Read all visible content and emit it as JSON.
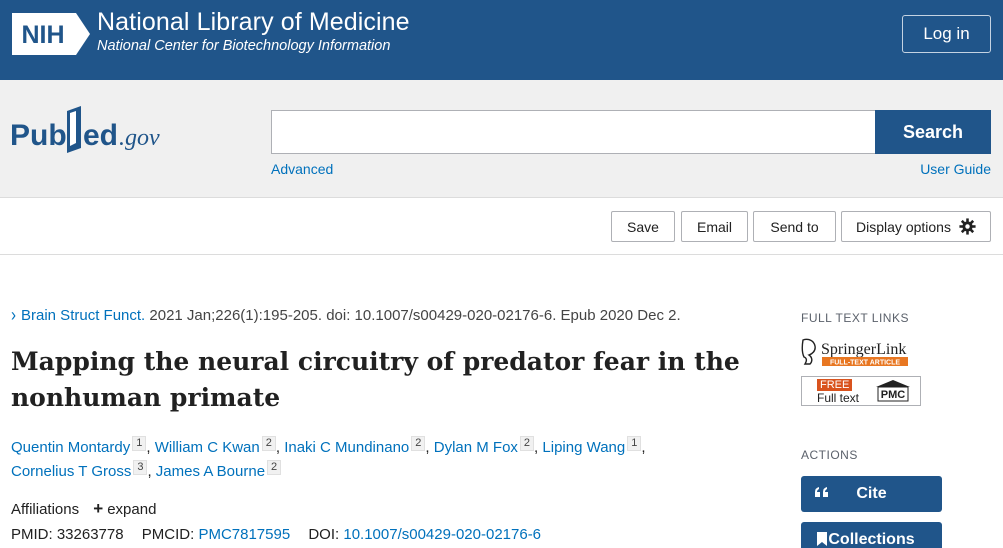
{
  "header": {
    "logo_text": "NIH",
    "org_title": "National Library of Medicine",
    "org_subtitle": "National Center for Biotechnology Information",
    "login_label": "Log in"
  },
  "search": {
    "logo_text": "PubMed.gov",
    "placeholder": "",
    "button_label": "Search",
    "advanced_label": "Advanced",
    "guide_label": "User Guide"
  },
  "toolbar": {
    "save_label": "Save",
    "email_label": "Email",
    "send_label": "Send to",
    "display_label": "Display options"
  },
  "article": {
    "journal": "Brain Struct Funct.",
    "citation": "2021 Jan;226(1):195-205. doi: 10.1007/s00429-020-02176-6. Epub 2020 Dec 2.",
    "title": "Mapping the neural circuitry of predator fear in the nonhuman primate",
    "authors": [
      {
        "name": "Quentin Montardy",
        "aff": "1"
      },
      {
        "name": "William C Kwan",
        "aff": "2"
      },
      {
        "name": "Inaki C Mundinano",
        "aff": "2"
      },
      {
        "name": "Dylan M Fox",
        "aff": "2"
      },
      {
        "name": "Liping Wang",
        "aff": "1"
      },
      {
        "name": "Cornelius T Gross",
        "aff": "3"
      },
      {
        "name": "James A Bourne",
        "aff": "2"
      }
    ],
    "affiliations_label": "Affiliations",
    "expand_label": "expand",
    "pmid_label": "PMID:",
    "pmid": "33263778",
    "pmcid_label": "PMCID:",
    "pmcid": "PMC7817595",
    "doi_label": "DOI:",
    "doi": "10.1007/s00429-020-02176-6"
  },
  "sidebar": {
    "full_text_heading": "FULL TEXT LINKS",
    "springer_label": "SpringerLink",
    "springer_sub": "FULL-TEXT ARTICLE",
    "pmc_free": "FREE",
    "pmc_full": "Full text",
    "pmc_logo": "PMC",
    "actions_heading": "ACTIONS",
    "cite_label": "Cite",
    "collections_label": "Collections"
  },
  "colors": {
    "brand_blue": "#20558a",
    "link_blue": "#0071bc",
    "springer_orange": "#e87722",
    "pmc_red": "#d9531e"
  }
}
